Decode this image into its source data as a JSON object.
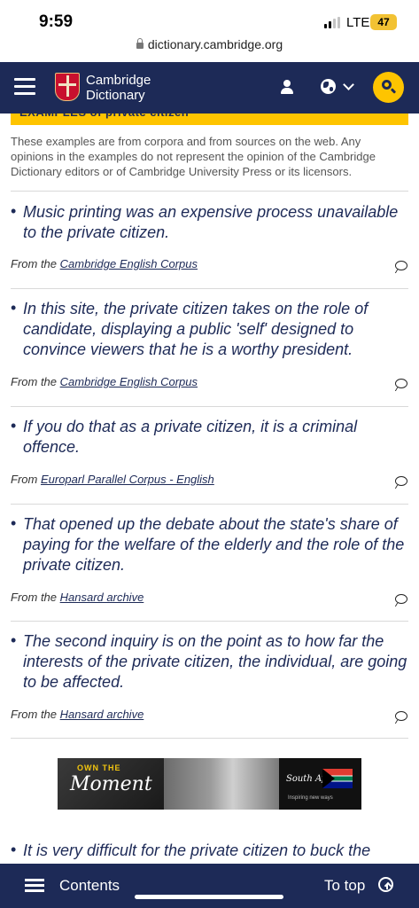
{
  "status_bar": {
    "time": "9:59",
    "network": "LTE",
    "battery": "47"
  },
  "browser": {
    "url": "dictionary.cambridge.org"
  },
  "header": {
    "logo_line1": "Cambridge",
    "logo_line2": "Dictionary",
    "search_color": "#fec400",
    "brand_color": "#1d2a57"
  },
  "section": {
    "heading": "EXAMPLES of private citizen",
    "disclaimer": "These examples are from corpora and from sources on the web. Any opinions in the examples do not represent the opinion of the Cambridge Dictionary editors or of Cambridge University Press or its licensors."
  },
  "examples": [
    {
      "sentence": "Music printing was an expensive process unavailable to the private citizen.",
      "source_prefix": "From the",
      "source_link": "Cambridge English Corpus"
    },
    {
      "sentence": "In this site, the private citizen takes on the role of candidate, displaying a public 'self' designed to convince viewers that he is a worthy president.",
      "source_prefix": "From the",
      "source_link": "Cambridge English Corpus"
    },
    {
      "sentence": "If you do that as a private citizen, it is a criminal offence.",
      "source_prefix": "From",
      "source_link": "Europarl Parallel Corpus - English"
    },
    {
      "sentence": "That opened up the debate about the state's share of paying for the welfare of the elderly and the role of the private citizen.",
      "source_prefix": "From the",
      "source_link": "Hansard archive"
    },
    {
      "sentence": "The second inquiry is on the point as to how far the interests of the private citizen, the individual, are going to be affected.",
      "source_prefix": "From the",
      "source_link": "Hansard archive"
    }
  ],
  "ad": {
    "tag": "OWN THE",
    "headline": "Moment",
    "brand": "South Africa",
    "slogan": "Inspiring new ways"
  },
  "partial_example": {
    "sentence": "It is very difficult for the private citizen to buck the"
  },
  "bottom_bar": {
    "contents_label": "Contents",
    "to_top_label": "To top"
  }
}
